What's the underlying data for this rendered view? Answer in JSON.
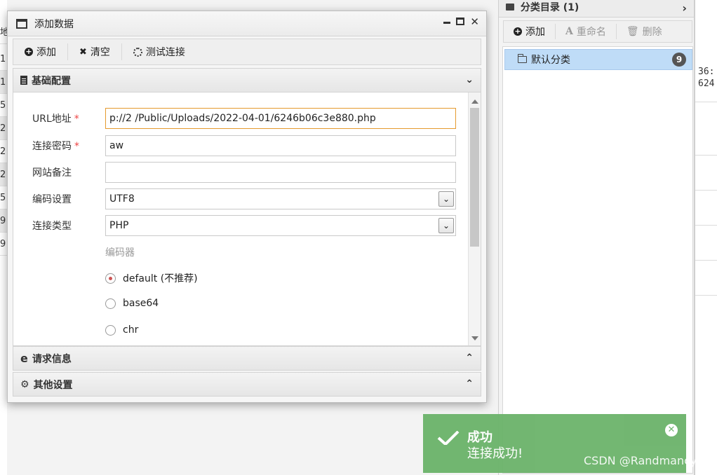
{
  "background": {
    "left_rows": [
      "地",
      "1",
      "1",
      "5",
      "2",
      "2",
      "2",
      "5",
      "9",
      "9"
    ],
    "right_rows": [
      "36:",
      "624"
    ]
  },
  "category_panel": {
    "title": "分类目录 (1)",
    "toolbar": {
      "add_label": "添加",
      "rename_label": "重命名",
      "delete_label": "删除"
    },
    "items": [
      {
        "label": "默认分类",
        "count": "9"
      }
    ]
  },
  "dialog": {
    "title": "添加数据",
    "toolbar": {
      "add_label": "添加",
      "clear_label": "清空",
      "test_label": "测试连接"
    },
    "sections": {
      "basic": "基础配置",
      "request": "请求信息",
      "other": "其他设置"
    },
    "form": {
      "url_label": "URL地址",
      "url_value": "p://2​​​​​ ​​​​​/Public/Uploads/2022-04-01/6246b06c3e880.php",
      "password_label": "连接密码",
      "password_value": "aw",
      "note_label": "网站备注",
      "note_value": "",
      "encoding_label": "编码设置",
      "encoding_value": "UTF8",
      "type_label": "连接类型",
      "type_value": "PHP",
      "encoder_title": "编码器",
      "encoders": [
        "default (不推荐)",
        "base64",
        "chr"
      ],
      "required_mark": "*"
    }
  },
  "toast": {
    "title": "成功",
    "message": "连接成功!"
  },
  "watermark": "CSDN @Randmancy",
  "colors": {
    "toast_bg": "#6bb36a",
    "selected_item_bg": "#bfdcf7",
    "focus_border": "#e59a2e",
    "required": "#e44444"
  }
}
